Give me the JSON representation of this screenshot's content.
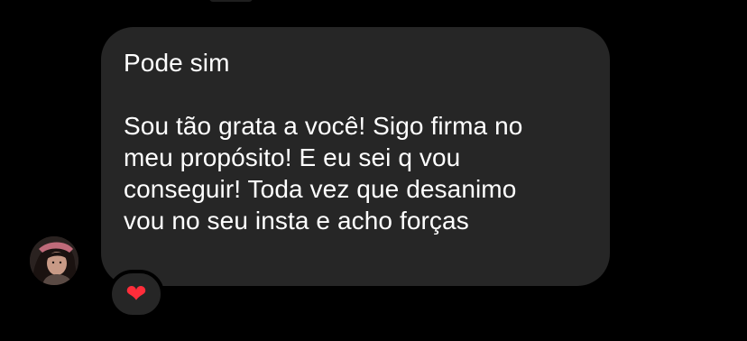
{
  "message": {
    "lines": [
      "Pode sim",
      "Sou tão grata a você! Sigo firma no",
      "meu propósito! E eu sei q vou",
      "conseguir! Toda vez que desanimo",
      "vou no seu insta e acho forças"
    ]
  },
  "reaction": {
    "emoji": "❤"
  },
  "colors": {
    "background": "#000000",
    "bubble": "#262626",
    "text": "#ffffff",
    "heart": "#ff2d3a"
  },
  "icons": {
    "avatar": "sender-avatar",
    "reaction": "heart-icon"
  }
}
